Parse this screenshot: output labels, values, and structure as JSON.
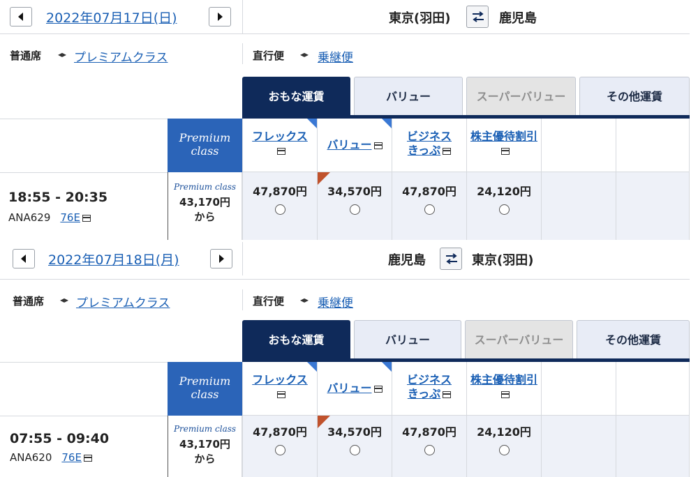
{
  "sections": [
    {
      "date": "2022年07月17日(日)",
      "from": "東京(羽田)",
      "to": "鹿児島",
      "cabin_current": "普通席",
      "cabin_other": "プレミアムクラス",
      "route_current": "直行便",
      "route_other": "乗継便",
      "tabs": [
        "おもな運賃",
        "バリュー",
        "スーパーバリュー",
        "その他運賃"
      ],
      "premium_header": [
        "Premium",
        "class"
      ],
      "fare_headers": [
        "フレックス",
        "バリュー",
        "ビジネス",
        "きっぷ",
        "株主優待割引"
      ],
      "flight": {
        "time": "18:55 - 20:35",
        "number": "ANA629",
        "aircraft": "76E",
        "premium_logo": "Premium class",
        "premium_price": "43,170円",
        "premium_suffix": "から",
        "fares": [
          "47,870円",
          "34,570円",
          "47,870円",
          "24,120円"
        ]
      }
    },
    {
      "date": "2022年07月18日(月)",
      "from": "鹿児島",
      "to": "東京(羽田)",
      "cabin_current": "普通席",
      "cabin_other": "プレミアムクラス",
      "route_current": "直行便",
      "route_other": "乗継便",
      "tabs": [
        "おもな運賃",
        "バリュー",
        "スーパーバリュー",
        "その他運賃"
      ],
      "premium_header": [
        "Premium",
        "class"
      ],
      "fare_headers": [
        "フレックス",
        "バリュー",
        "ビジネス",
        "きっぷ",
        "株主優待割引"
      ],
      "flight": {
        "time": "07:55 - 09:40",
        "number": "ANA620",
        "aircraft": "76E",
        "premium_logo": "Premium class",
        "premium_price": "43,170円",
        "premium_suffix": "から",
        "fares": [
          "47,870円",
          "34,570円",
          "47,870円",
          "24,120円"
        ]
      }
    }
  ],
  "icons": {
    "prev": "chevron-left-icon",
    "next": "chevron-right-icon",
    "swap": "swap-arrows-icon",
    "toggle": "left-right-toggle-icon",
    "card": "card-icon"
  },
  "colors": {
    "navy": "#0f2a5a",
    "link": "#1a5fb4",
    "premium_blue": "#2b64b8",
    "fare_bg": "#eef1f8",
    "discount_marker": "#c0522c"
  }
}
